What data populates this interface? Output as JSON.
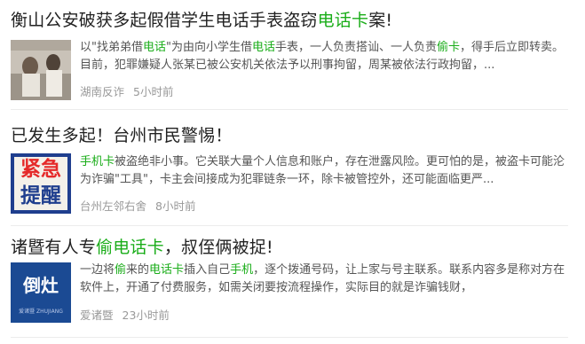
{
  "articles": [
    {
      "title_parts": [
        "衡山公安破获多起假借学生电话手表盗窃",
        "电话卡",
        "案!"
      ],
      "snippet_parts": [
        "以\"找弟弟借",
        "电话",
        "\"为由向小学生借",
        "电话",
        "手表，一人负责搭讪、一人负责",
        "偷卡",
        "，得手后立即转卖。目前，犯罪嫌疑人张某已被公安机关依法予以刑事拘留，周某被依法行政拘留，..."
      ],
      "source": "湖南反诈",
      "time": "5小时前"
    },
    {
      "title_parts": [
        "已发生多起！台州市民警惕！"
      ],
      "snippet_parts": [
        "手机卡",
        "被盗绝非小事。它关联大量个人信息和账户，存在泄露风险。更可怕的是，被盗卡可能沦为诈骗\"工具\"，卡主会间接成为犯罪链条一环，除卡被管控外，还可能面临更严..."
      ],
      "source": "台州左邻右舍",
      "time": "8小时前",
      "thumb_text": [
        "紧急",
        "提醒"
      ]
    },
    {
      "title_parts": [
        "诸暨有人专",
        "偷电话卡",
        "，叔侄俩被捉!"
      ],
      "snippet_parts": [
        "一边将",
        "偷",
        "来的",
        "电话卡",
        "插入自己",
        "手机",
        "，逐个拨通号码，让上家与号主联系。联系内容多是称对方在软件上，开通了付费服务，如需关闭要按流程操作，实际目的就是诈骗钱财，"
      ],
      "source": "爱诸暨",
      "time": "23小时前",
      "thumb_text": [
        "倒灶",
        "爱诸暨 ZHUJIANG"
      ]
    }
  ],
  "colors": {
    "highlight": "#1aad19",
    "meta": "#999999",
    "title": "#222222"
  }
}
